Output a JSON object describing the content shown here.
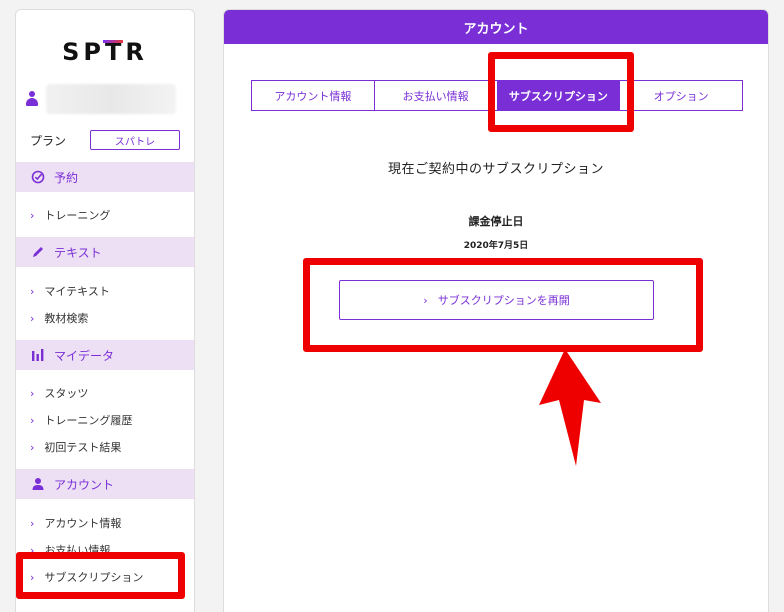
{
  "app": {
    "logo": "SPTR",
    "user_name": "",
    "plan_label": "プラン",
    "plan_value": "スパトレ"
  },
  "sidebar": {
    "sections": [
      {
        "label": "予約",
        "icon": "check-circle-icon",
        "items": [
          "トレーニング"
        ]
      },
      {
        "label": "テキスト",
        "icon": "pencil-icon",
        "items": [
          "マイテキスト",
          "教材検索"
        ]
      },
      {
        "label": "マイデータ",
        "icon": "bar-chart-icon",
        "items": [
          "スタッツ",
          "トレーニング履歴",
          "初回テスト結果"
        ]
      },
      {
        "label": "アカウント",
        "icon": "person-icon",
        "items": [
          "アカウント情報",
          "お支払い情報",
          "サブスクリプション"
        ]
      }
    ]
  },
  "main": {
    "header": "アカウント",
    "tabs": [
      {
        "label": "アカウント情報",
        "active": false
      },
      {
        "label": "お支払い情報",
        "active": false
      },
      {
        "label": "サブスクリプション",
        "active": true
      },
      {
        "label": "オプション",
        "active": false
      }
    ],
    "current_title": "現在ご契約中のサブスクリプション",
    "stop_label": "課金停止日",
    "stop_date": "2020年7月5日",
    "resume_button": "サブスクリプションを再開"
  },
  "colors": {
    "accent": "#7a2fd6",
    "section_bg": "#eee0f4",
    "annotation": "#ee0000"
  }
}
